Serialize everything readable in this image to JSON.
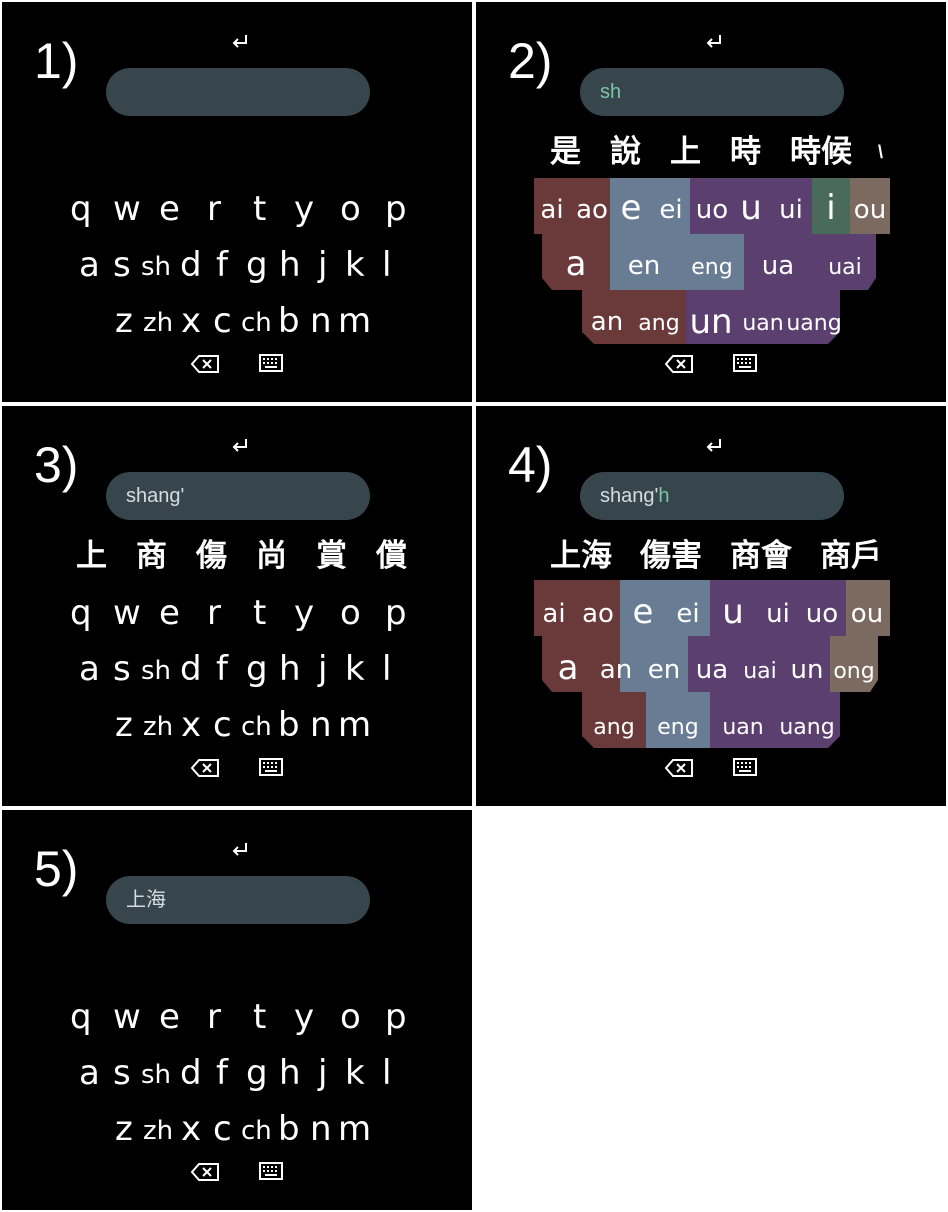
{
  "colors": {
    "panel_bg": "#000000",
    "input_bg": "#37454c",
    "input_text": "#d6dde0",
    "input_highlight": "#7cc4a6",
    "vowel_brown": "#6a3a3a",
    "vowel_slate": "#687c94",
    "vowel_purple": "#5b3f6e",
    "vowel_green": "#4a6a5c",
    "vowel_taupe": "#7a6a60"
  },
  "icons": {
    "enter": "return-arrow-icon",
    "backspace": "backspace-icon",
    "keyboard": "keyboard-icon"
  },
  "panels": [
    {
      "step": "1)",
      "input": {
        "text": "",
        "highlight": ""
      },
      "candidates": [],
      "keyboard": {
        "rows": [
          [
            "q",
            "w",
            "e",
            "r",
            "t",
            "y",
            "o",
            "p"
          ],
          [
            "a",
            "s",
            "sh",
            "d",
            "f",
            "g",
            "h",
            "j",
            "k",
            "l"
          ],
          [
            "z",
            "zh",
            "x",
            "c",
            "ch",
            "b",
            "n",
            "m"
          ]
        ]
      }
    },
    {
      "step": "2)",
      "input": {
        "text": "",
        "highlight": "sh"
      },
      "candidates": [
        "是",
        "說",
        "上",
        "時",
        "時候",
        "\\"
      ],
      "vowel_keys": [
        "ai",
        "ao",
        "e",
        "ei",
        "uo",
        "u",
        "ui",
        "i",
        "ou",
        "a",
        "en",
        "eng",
        "ua",
        "uai",
        "an",
        "ang",
        "un",
        "uan",
        "uang"
      ]
    },
    {
      "step": "3)",
      "input": {
        "text": "shang'",
        "highlight": ""
      },
      "candidates": [
        "上",
        "商",
        "傷",
        "尚",
        "賞",
        "償"
      ],
      "keyboard": {
        "rows": [
          [
            "q",
            "w",
            "e",
            "r",
            "t",
            "y",
            "o",
            "p"
          ],
          [
            "a",
            "s",
            "sh",
            "d",
            "f",
            "g",
            "h",
            "j",
            "k",
            "l"
          ],
          [
            "z",
            "zh",
            "x",
            "c",
            "ch",
            "b",
            "n",
            "m"
          ]
        ]
      }
    },
    {
      "step": "4)",
      "input": {
        "text": "shang'",
        "highlight": "h"
      },
      "candidates": [
        "上海",
        "傷害",
        "商會",
        "商戶"
      ],
      "vowel_keys": [
        "ai",
        "ao",
        "e",
        "ei",
        "u",
        "ui",
        "uo",
        "ou",
        "a",
        "an",
        "en",
        "ua",
        "uai",
        "un",
        "ong",
        "ang",
        "eng",
        "uan",
        "uang"
      ]
    },
    {
      "step": "5)",
      "input": {
        "text": "上海",
        "highlight": ""
      },
      "candidates": [],
      "keyboard": {
        "rows": [
          [
            "q",
            "w",
            "e",
            "r",
            "t",
            "y",
            "o",
            "p"
          ],
          [
            "a",
            "s",
            "sh",
            "d",
            "f",
            "g",
            "h",
            "j",
            "k",
            "l"
          ],
          [
            "z",
            "zh",
            "x",
            "c",
            "ch",
            "b",
            "n",
            "m"
          ]
        ]
      }
    }
  ]
}
